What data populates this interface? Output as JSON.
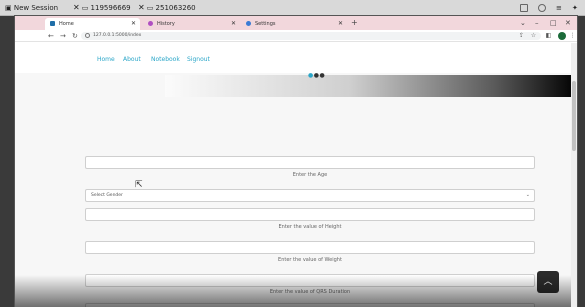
{
  "session_bar": {
    "title": "New Session",
    "sessions": [
      "119596669",
      "251063260"
    ]
  },
  "browser": {
    "tabs": [
      {
        "label": "Home",
        "favicon": "#1f6ea8"
      },
      {
        "label": "History",
        "favicon": "#b04fc2"
      },
      {
        "label": "Settings",
        "favicon": "#3a7bd5"
      }
    ],
    "url": "127.0.0.1:5000/index"
  },
  "navbar": {
    "links": [
      "Home",
      "About",
      "Notebook",
      "Signout"
    ]
  },
  "form": {
    "age_hint": "Enter the Age",
    "gender_select": "Select Gender",
    "height_hint": "Enter the value of Height",
    "weight_hint": "Enter the value of Weight",
    "qrs_hint": "Enter the value of QRS Duration"
  },
  "icons": {
    "scroll_top": "chevron-up-icon"
  }
}
